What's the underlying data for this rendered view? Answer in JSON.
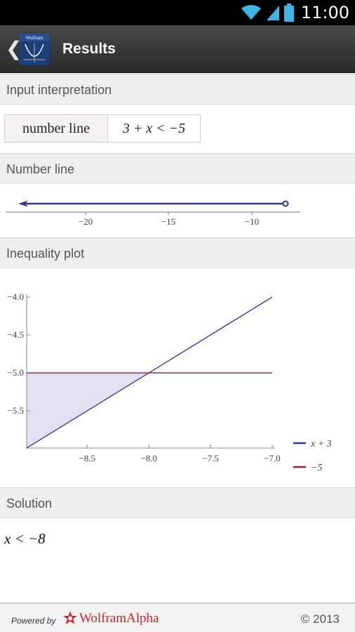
{
  "status_bar": {
    "time": "11:00"
  },
  "action_bar": {
    "title": "Results",
    "logo_text": "Wolfram"
  },
  "pods": {
    "input_interpretation": {
      "title": "Input interpretation",
      "cell1": "number line",
      "cell2": "3 + x < −5"
    },
    "number_line": {
      "title": "Number line",
      "ticks": [
        "−20",
        "−15",
        "−10"
      ]
    },
    "inequality_plot": {
      "title": "Inequality plot",
      "y_ticks": [
        "−4.0",
        "−4.5",
        "−5.0",
        "−5.5"
      ],
      "x_ticks": [
        "−8.5",
        "−8.0",
        "−7.5",
        "−7.0"
      ],
      "legend": [
        "x + 3",
        "−5"
      ]
    },
    "solution": {
      "title": "Solution",
      "text": "x < −8"
    }
  },
  "footer": {
    "powered_by": "Powered by",
    "brand": "WolframAlpha",
    "copyright": "© 2013"
  },
  "colors": {
    "series_line": "#2b3797",
    "constant_line": "#8a1a4f",
    "fill": "#ddd8f0",
    "brand_red": "#d2232a"
  },
  "chart_data": [
    {
      "type": "line",
      "title": "",
      "xlabel": "",
      "ylabel": "",
      "xlim": [
        -8.99,
        -7.0
      ],
      "ylim": [
        -5.99,
        -4.0
      ],
      "series": [
        {
          "name": "x + 3",
          "x": [
            -8.99,
            -7.0
          ],
          "y": [
            -5.99,
            -4.0
          ]
        },
        {
          "name": "−5",
          "x": [
            -8.99,
            -7.0
          ],
          "y": [
            -5.0,
            -5.0
          ]
        }
      ],
      "shaded_region": {
        "x": [
          -8.99,
          -8.0
        ],
        "between": [
          "x + 3",
          "−5"
        ]
      },
      "legend": "right",
      "grid": false
    }
  ]
}
